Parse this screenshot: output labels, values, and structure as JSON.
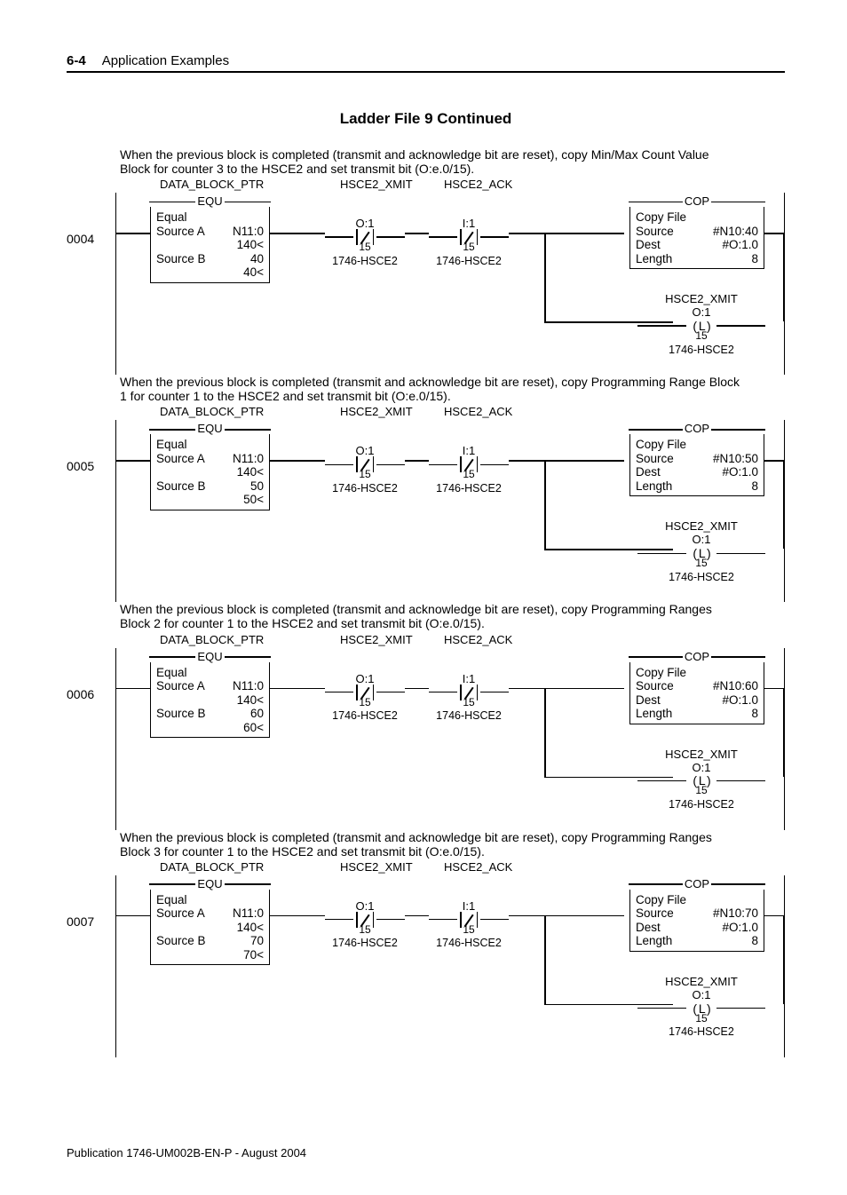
{
  "header": {
    "pageNum": "6-4",
    "section": "Application Examples"
  },
  "title": "Ladder File 9 Continued",
  "labels": {
    "dataBlockPtr": "DATA_BLOCK_PTR",
    "hsce2Xmit": "HSCE2_XMIT",
    "hsce2Ack": "HSCE2_ACK",
    "module": "1746-HSCE2",
    "equTitle": "EQU",
    "equal": "Equal",
    "sourceA": "Source A",
    "sourceB": "Source B",
    "n110": "N11:0",
    "v140": "140<",
    "copTitle": "COP",
    "copyFile": "Copy File",
    "src": "Source",
    "dest": "Dest",
    "len": "Length",
    "destVal": "#O:1.0",
    "lenVal": "8",
    "xmitAddr": "O:1",
    "ackAddr": "I:1",
    "bit15": "15",
    "otlLetter": "L"
  },
  "rungs": [
    {
      "num": "0004",
      "comment": "When the previous block is completed (transmit and acknowledge bit are reset), copy Min/Max Count Value Block for counter 3 to the HSCE2 and set transmit bit (O:e.0/15).",
      "sourceB": "40",
      "sourceBDisp": "40<",
      "copSrc": "#N10:40"
    },
    {
      "num": "0005",
      "comment": "When the previous block is completed (transmit and acknowledge bit are reset), copy Programming Range Block 1 for counter 1 to the HSCE2 and set transmit bit (O:e.0/15).",
      "sourceB": "50",
      "sourceBDisp": "50<",
      "copSrc": "#N10:50"
    },
    {
      "num": "0006",
      "comment": "When the previous block is completed (transmit and acknowledge bit are reset), copy Programming Ranges Block 2 for counter 1 to the HSCE2 and set transmit bit (O:e.0/15).",
      "sourceB": "60",
      "sourceBDisp": "60<",
      "copSrc": "#N10:60"
    },
    {
      "num": "0007",
      "comment": "When the previous block is completed (transmit and acknowledge bit are reset), copy Programming Ranges Block 3 for counter 1 to the HSCE2 and set transmit bit (O:e.0/15).",
      "sourceB": "70",
      "sourceBDisp": "70<",
      "copSrc": "#N10:70"
    }
  ],
  "footer": "Publication 1746-UM002B-EN-P - August 2004"
}
